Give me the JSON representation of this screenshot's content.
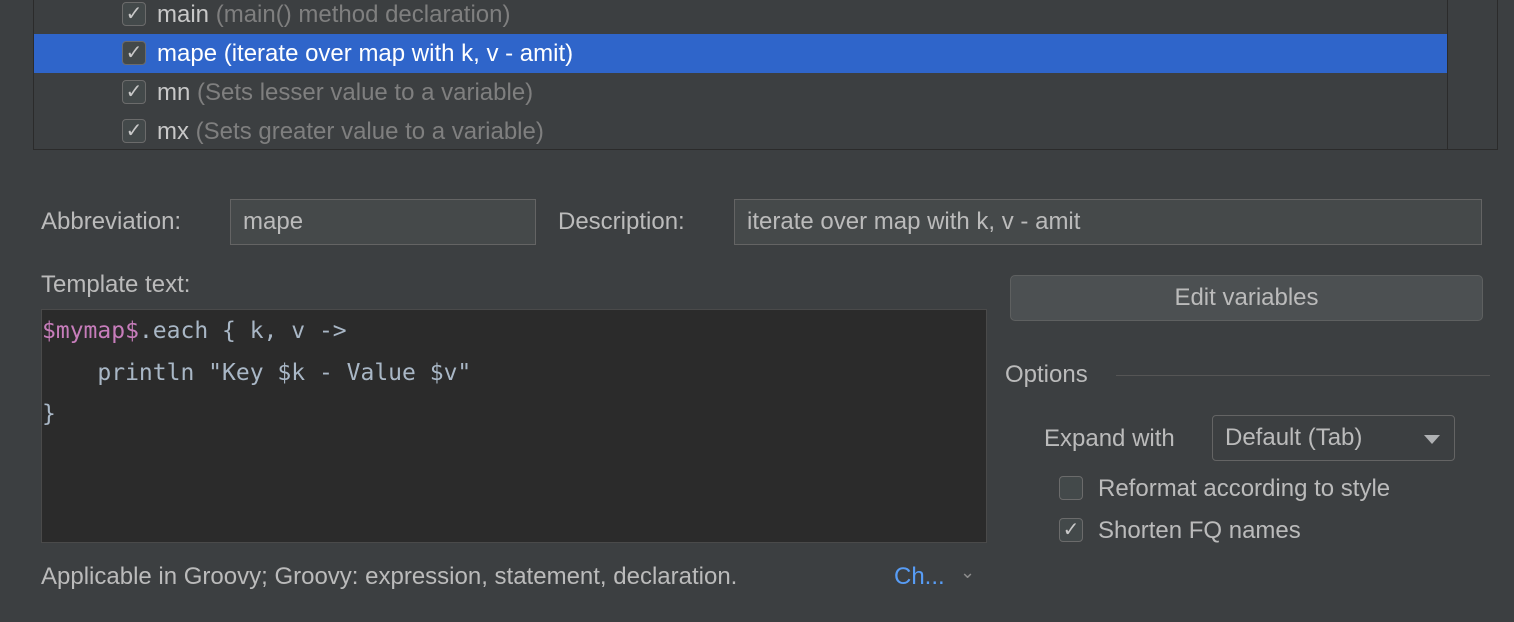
{
  "templates": [
    {
      "name": "main",
      "desc": "(main() method declaration)",
      "checked": true,
      "selected": false
    },
    {
      "name": "mape",
      "desc": "(iterate over map with k, v - amit)",
      "checked": true,
      "selected": true
    },
    {
      "name": "mn",
      "desc": "(Sets lesser value to a variable)",
      "checked": true,
      "selected": false
    },
    {
      "name": "mx",
      "desc": "(Sets greater value to a variable)",
      "checked": true,
      "selected": false
    }
  ],
  "form": {
    "abbreviation_label": "Abbreviation:",
    "abbreviation": "mape",
    "description_label": "Description:",
    "description": "iterate over map with k, v - amit",
    "template_label": "Template text:"
  },
  "code": {
    "l1_var": "$mymap$",
    "l1_rest": ".each { k, v ->",
    "l2": "    println \"Key $k - Value $v\"",
    "l3": "}"
  },
  "edit_variables": "Edit variables",
  "options": {
    "title": "Options",
    "expand_label": "Expand with",
    "expand_value": "Default (Tab)",
    "reformat": "Reformat according to style",
    "reformat_checked": false,
    "shorten": "Shorten FQ names",
    "shorten_checked": true
  },
  "footer": {
    "applicable": "Applicable in Groovy; Groovy: expression, statement, declaration.",
    "change_link": "Ch..."
  },
  "colors": {
    "selection": "#2f65ca",
    "link": "#589df6",
    "variable": "#c77dbb"
  }
}
